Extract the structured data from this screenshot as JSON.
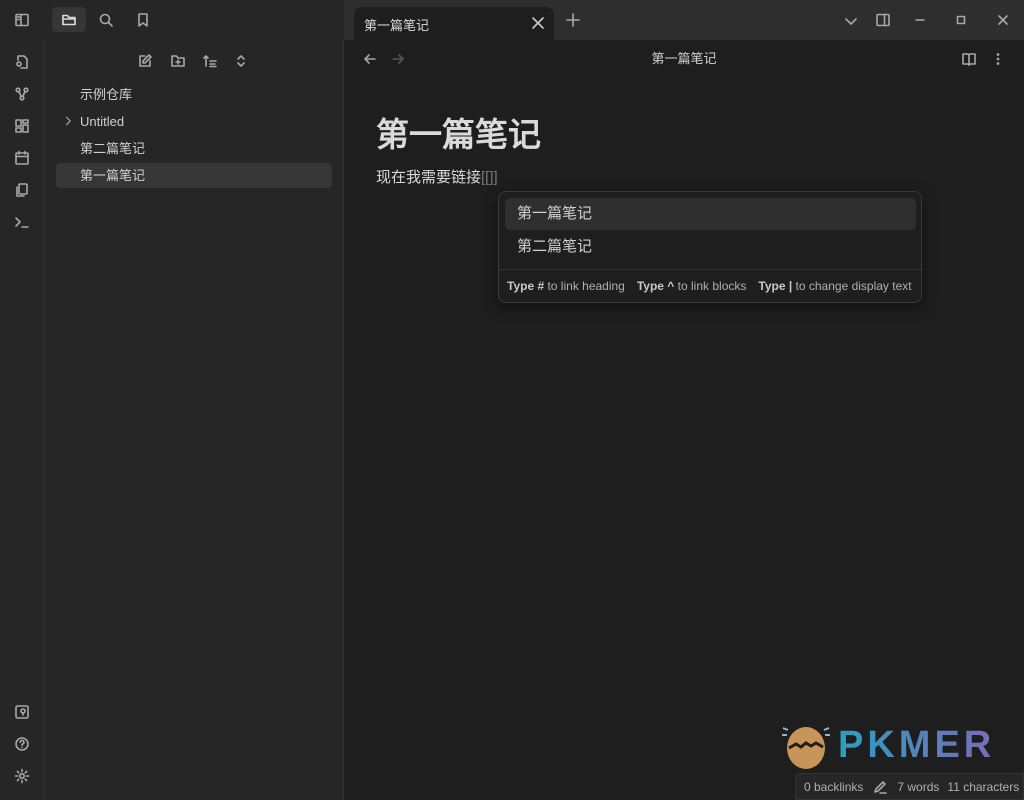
{
  "tab": {
    "title": "第一篇笔记"
  },
  "file_tree": {
    "vault": "示例仓库",
    "items": [
      {
        "label": "Untitled",
        "folder": true
      },
      {
        "label": "第二篇笔记"
      },
      {
        "label": "第一篇笔记",
        "active": true
      }
    ]
  },
  "editor": {
    "header_title": "第一篇笔记",
    "heading": "第一篇笔记",
    "paragraph": "现在我需要链接",
    "link_brackets": "[[]]"
  },
  "suggest": {
    "items": [
      "第一篇笔记",
      "第二篇笔记"
    ],
    "hints": [
      {
        "key": "Type #",
        "text": "to link heading"
      },
      {
        "key": "Type ^",
        "text": "to link blocks"
      },
      {
        "key": "Type |",
        "text": "to change display text"
      }
    ]
  },
  "status": {
    "backlinks": "0 backlinks",
    "words": "7 words",
    "chars": "11 characters"
  },
  "watermark": "PKMER"
}
